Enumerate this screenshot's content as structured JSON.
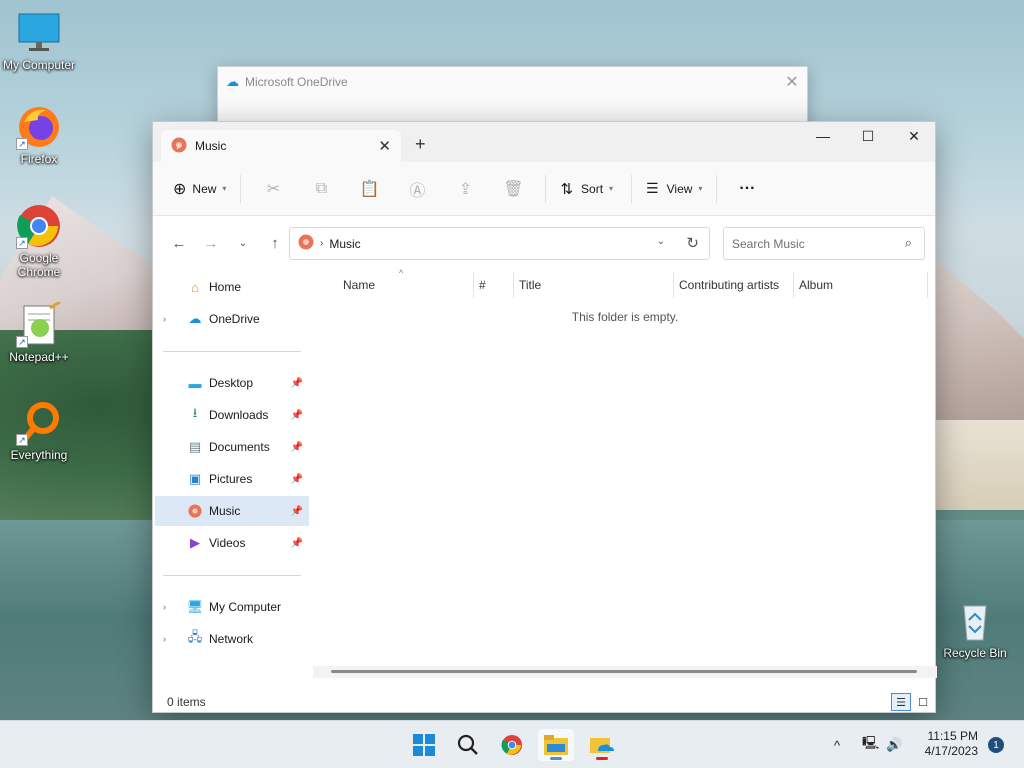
{
  "desktop": {
    "icons": [
      {
        "label": "My Computer"
      },
      {
        "label": "Firefox"
      },
      {
        "label": "Google Chrome"
      },
      {
        "label": "Notepad++"
      },
      {
        "label": "Everything"
      },
      {
        "label": "Recycle Bin"
      }
    ]
  },
  "onedrive_window": {
    "title": "Microsoft OneDrive"
  },
  "explorer": {
    "tab_title": "Music",
    "commandbar": {
      "new_label": "New",
      "sort_label": "Sort",
      "view_label": "View",
      "more_label": "···"
    },
    "address": {
      "crumb": "Music",
      "search_placeholder": "Search Music"
    },
    "sidebar": {
      "top": [
        {
          "label": "Home"
        },
        {
          "label": "OneDrive"
        }
      ],
      "pinned": [
        {
          "label": "Desktop"
        },
        {
          "label": "Downloads"
        },
        {
          "label": "Documents"
        },
        {
          "label": "Pictures"
        },
        {
          "label": "Music"
        },
        {
          "label": "Videos"
        }
      ],
      "bottom": [
        {
          "label": "My Computer"
        },
        {
          "label": "Network"
        }
      ]
    },
    "columns": [
      "Name",
      "#",
      "Title",
      "Contributing artists",
      "Album"
    ],
    "empty_message": "This folder is empty.",
    "status": "0 items"
  },
  "taskbar": {
    "time": "11:15 PM",
    "date": "4/17/2023",
    "notification_count": "1"
  }
}
